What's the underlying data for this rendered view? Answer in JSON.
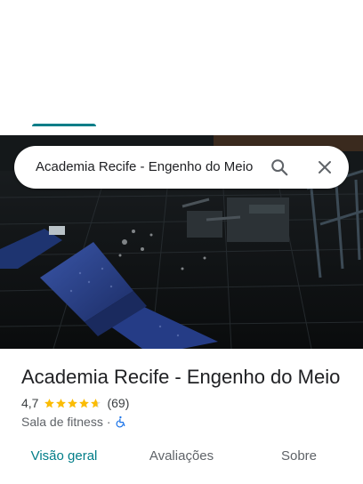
{
  "search": {
    "query": "Academia Recife - Engenho do Meio",
    "search_icon": "search-icon",
    "close_icon": "close-icon"
  },
  "place": {
    "name": "Academia Recife - Engenho do Meio",
    "rating": "4,7",
    "stars_value": 4.7,
    "stars_max": 5,
    "reviews": "(69)",
    "category": "Sala de fitness",
    "separator": "·",
    "accessibility_icon": "wheelchair-icon"
  },
  "tabs": [
    {
      "label": "Visão geral",
      "active": true
    },
    {
      "label": "Avaliações",
      "active": false
    },
    {
      "label": "Sobre",
      "active": false
    }
  ],
  "colors": {
    "accent": "#017d88",
    "star": "#fbbc04",
    "accessibility": "#1a73e8"
  }
}
